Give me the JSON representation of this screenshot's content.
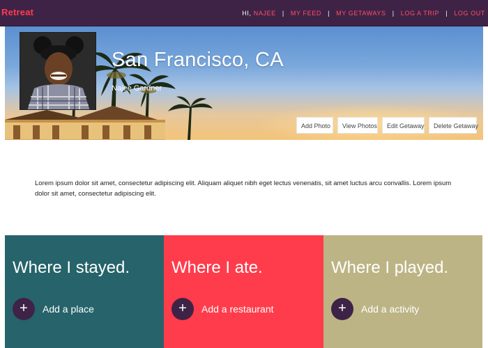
{
  "brand": {
    "logo": "Retreat"
  },
  "nav": {
    "greeting": "HI,",
    "user": "NAJEE",
    "sep": "|",
    "links": [
      "MY FEED",
      "MY GETAWAYS",
      "LOG A TRIP",
      "LOG OUT"
    ]
  },
  "hero": {
    "city": "San Francisco, CA",
    "owner": "Najee Gardner",
    "actions": [
      "Add Photo",
      "View Photos",
      "Edit Getaway",
      "Delete Getaway"
    ]
  },
  "description": "Lorem ipsum dolor sit amet, consectetur adipiscing elit. Aliquam aliquet nibh eget lectus venenatis, sit amet luctus arcu convallis. Lorem ipsum dolor sit amet, consectetur adipiscing elit.",
  "panels": [
    {
      "title": "Where I stayed.",
      "add": "Add a place",
      "plus": "+"
    },
    {
      "title": "Where I ate.",
      "add": "Add a restaurant",
      "plus": "+"
    },
    {
      "title": "Where I played.",
      "add": "Add a activity",
      "plus": "+"
    }
  ],
  "colors": {
    "nav_bg": "#3e2347",
    "accent": "#ff3c4b",
    "stayed": "#26636a",
    "ate": "#ff3c4b",
    "played": "#bdb485"
  }
}
